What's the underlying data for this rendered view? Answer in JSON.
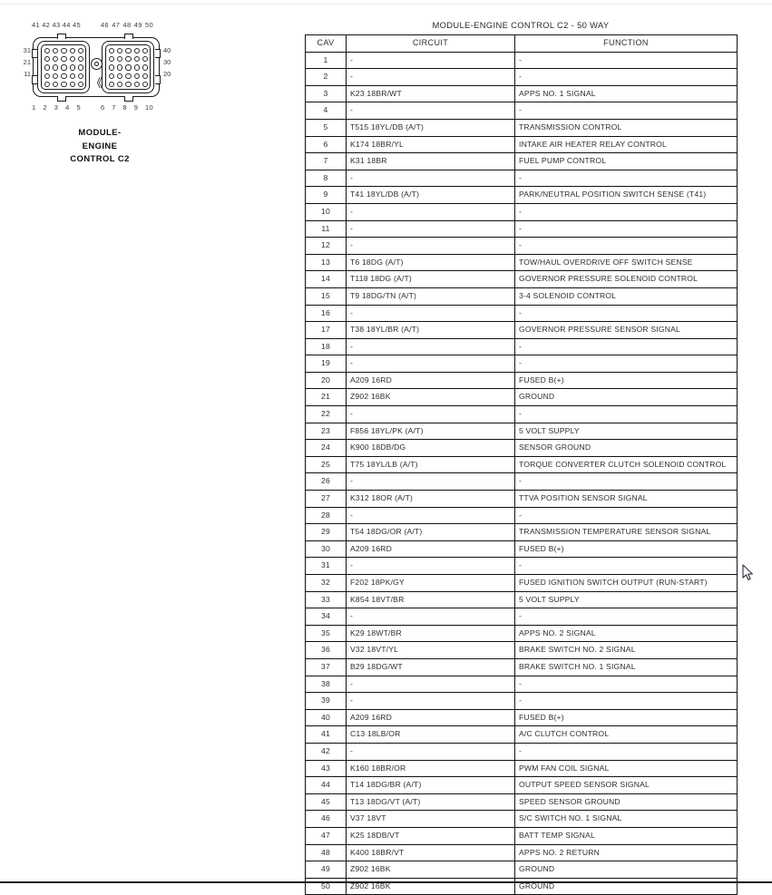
{
  "connector": {
    "title_lines": [
      "MODULE-",
      "ENGINE",
      "CONTROL C2"
    ],
    "top_pins_left": [
      "41",
      "42",
      "43",
      "44",
      "45"
    ],
    "top_pins_right": [
      "46",
      "47",
      "48",
      "49",
      "50"
    ],
    "bottom_pins_left": [
      "1",
      "2",
      "3",
      "4",
      "5"
    ],
    "bottom_pins_right": [
      "6",
      "7",
      "8",
      "9",
      "10"
    ],
    "side_labels_left": [
      "31",
      "21",
      "11"
    ],
    "side_labels_right": [
      "40",
      "30",
      "20"
    ],
    "keyway_glyph": "《"
  },
  "table": {
    "title": "MODULE-ENGINE CONTROL C2 - 50 WAY",
    "headers": [
      "CAV",
      "CIRCUIT",
      "FUNCTION"
    ],
    "rows": [
      [
        "1",
        "-",
        "-"
      ],
      [
        "2",
        "-",
        "-"
      ],
      [
        "3",
        "K23 18BR/WT",
        "APPS NO. 1 SIGNAL"
      ],
      [
        "4",
        "-",
        "-"
      ],
      [
        "5",
        "T515 18YL/DB (A/T)",
        "TRANSMISSION CONTROL"
      ],
      [
        "6",
        "K174 18BR/YL",
        "INTAKE AIR HEATER RELAY CONTROL"
      ],
      [
        "7",
        "K31 18BR",
        "FUEL PUMP CONTROL"
      ],
      [
        "8",
        "-",
        "-"
      ],
      [
        "9",
        "T41 18YL/DB (A/T)",
        "PARK/NEUTRAL POSITION SWITCH SENSE (T41)"
      ],
      [
        "10",
        "-",
        "-"
      ],
      [
        "11",
        "-",
        "-"
      ],
      [
        "12",
        "-",
        "-"
      ],
      [
        "13",
        "T6 18DG (A/T)",
        "TOW/HAUL OVERDRIVE OFF SWITCH SENSE"
      ],
      [
        "14",
        "T118 18DG (A/T)",
        "GOVERNOR PRESSURE SOLENOID CONTROL"
      ],
      [
        "15",
        "T9 18DG/TN (A/T)",
        "3-4 SOLENOID CONTROL"
      ],
      [
        "16",
        "-",
        "-"
      ],
      [
        "17",
        "T38 18YL/BR (A/T)",
        "GOVERNOR PRESSURE SENSOR SIGNAL"
      ],
      [
        "18",
        "-",
        "-"
      ],
      [
        "19",
        "-",
        "-"
      ],
      [
        "20",
        "A209 16RD",
        "FUSED B(+)"
      ],
      [
        "21",
        "Z902 16BK",
        "GROUND"
      ],
      [
        "22",
        "-",
        "-"
      ],
      [
        "23",
        "F856 18YL/PK (A/T)",
        "5 VOLT SUPPLY"
      ],
      [
        "24",
        "K900 18DB/DG",
        "SENSOR GROUND"
      ],
      [
        "25",
        "T75 18YL/LB (A/T)",
        "TORQUE CONVERTER CLUTCH SOLENOID CONTROL"
      ],
      [
        "26",
        "-",
        "-"
      ],
      [
        "27",
        "K312 18OR (A/T)",
        "TTVA POSITION SENSOR SIGNAL"
      ],
      [
        "28",
        "-",
        "-"
      ],
      [
        "29",
        "T54 18DG/OR (A/T)",
        "TRANSMISSION TEMPERATURE SENSOR SIGNAL"
      ],
      [
        "30",
        "A209 16RD",
        "FUSED B(+)"
      ],
      [
        "31",
        "-",
        "-"
      ],
      [
        "32",
        "F202 18PK/GY",
        "FUSED IGNITION SWITCH OUTPUT (RUN-START)"
      ],
      [
        "33",
        "K854 18VT/BR",
        "5 VOLT SUPPLY"
      ],
      [
        "34",
        "-",
        "-"
      ],
      [
        "35",
        "K29 18WT/BR",
        "APPS NO. 2 SIGNAL"
      ],
      [
        "36",
        "V32 18VT/YL",
        "BRAKE SWITCH NO. 2 SIGNAL"
      ],
      [
        "37",
        "B29 18DG/WT",
        "BRAKE SWITCH NO. 1 SIGNAL"
      ],
      [
        "38",
        "-",
        "-"
      ],
      [
        "39",
        "-",
        "-"
      ],
      [
        "40",
        "A209 16RD",
        "FUSED B(+)"
      ],
      [
        "41",
        "C13 18LB/OR",
        "A/C CLUTCH CONTROL"
      ],
      [
        "42",
        "-",
        "-"
      ],
      [
        "43",
        "K160 18BR/OR",
        "PWM FAN COIL SIGNAL"
      ],
      [
        "44",
        "T14 18DG/BR (A/T)",
        "OUTPUT SPEED SENSOR SIGNAL"
      ],
      [
        "45",
        "T13 18DG/VT (A/T)",
        "SPEED SENSOR GROUND"
      ],
      [
        "46",
        "V37 18VT",
        "S/C SWITCH NO. 1 SIGNAL"
      ],
      [
        "47",
        "K25 18DB/VT",
        "BATT TEMP SIGNAL"
      ],
      [
        "48",
        "K400 18BR/VT",
        "APPS NO. 2 RETURN"
      ],
      [
        "49",
        "Z902 16BK",
        "GROUND"
      ],
      [
        "50",
        "Z902 16BK",
        "GROUND"
      ]
    ]
  },
  "colors": {
    "ink": "#2e2e2e",
    "rule": "#111111",
    "page_bg": "#ffffff"
  }
}
